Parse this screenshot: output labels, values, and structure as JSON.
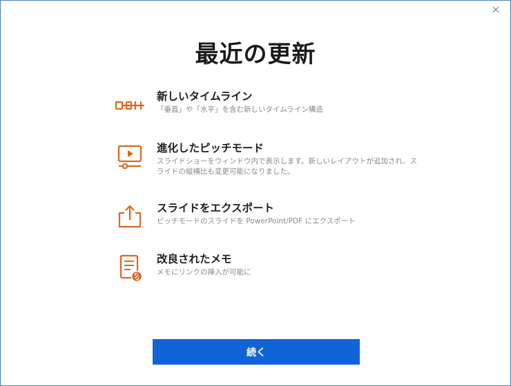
{
  "dialog": {
    "title": "最近の更新",
    "close_icon": "close-icon",
    "accent_color": "#e0641c",
    "button_color": "#0f64d8"
  },
  "features": [
    {
      "icon": "timeline-icon",
      "title": "新しいタイムライン",
      "description": "「垂直」や「水平」を含む新しいタイムライン構造"
    },
    {
      "icon": "pitch-mode-icon",
      "title": "進化したピッチモード",
      "description": "スライドショーをウィンドウ内で表示します。新しいレイアウトが追加され、スライドの縦横比も変更可能になりました。"
    },
    {
      "icon": "export-icon",
      "title": "スライドをエクスポート",
      "description": "ピッチモードのスライドを PowerPoint/PDF にエクスポート"
    },
    {
      "icon": "notes-link-icon",
      "title": "改良されたメモ",
      "description": "メモにリンクの挿入が可能に"
    }
  ],
  "continue_label": "続く"
}
